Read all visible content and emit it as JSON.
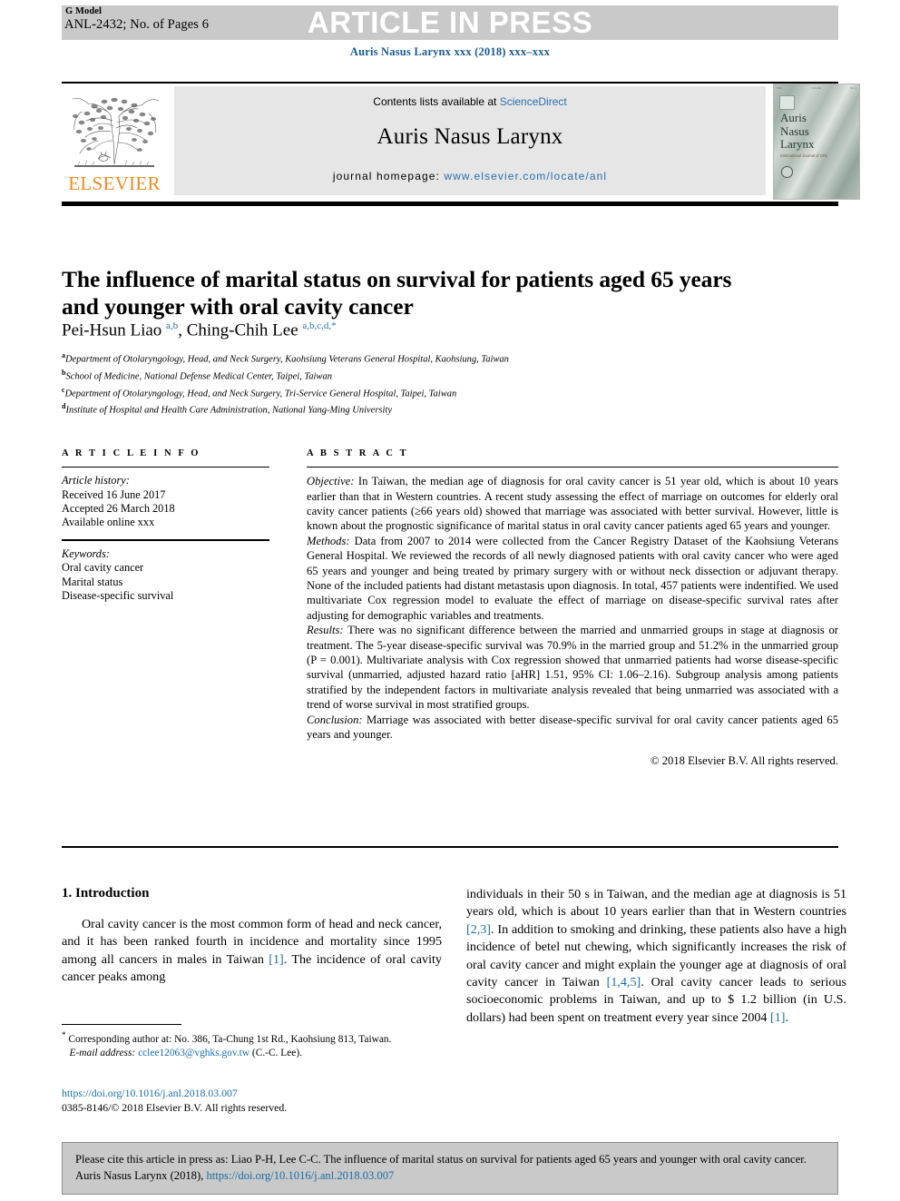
{
  "header": {
    "g_model": "G Model",
    "model_id": "ANL-2432; No. of Pages 6",
    "article_in_press": "ARTICLE IN PRESS",
    "journal_citation": "Auris Nasus Larynx xxx (2018) xxx–xxx"
  },
  "banner": {
    "publisher_word": "ELSEVIER",
    "contents_prefix": "Contents lists available at ",
    "contents_link": "ScienceDirect",
    "journal_title": "Auris Nasus Larynx",
    "homepage_prefix": "journal homepage: ",
    "homepage_url": "www.elsevier.com/locate/anl",
    "cover": {
      "title_line1": "Auris",
      "title_line2": "Nasus",
      "title_line3": "Larynx",
      "subtitle": "International Journal of ORL"
    }
  },
  "article": {
    "title": "The influence of marital status on survival for patients aged 65 years and younger with oral cavity cancer",
    "authors_html": "Pei-Hsun Liao <sup>a,b</sup>, Ching-Chih Lee <sup>a,b,c,d,</sup><sup>*</sup>",
    "affiliations": [
      {
        "marker": "a",
        "text": "Department of Otolaryngology, Head, and Neck Surgery, Kaohsiung Veterans General Hospital, Kaohsiung, Taiwan"
      },
      {
        "marker": "b",
        "text": "School of Medicine, National Defense Medical Center, Taipei, Taiwan"
      },
      {
        "marker": "c",
        "text": "Department of Otolaryngology, Head, and Neck Surgery, Tri-Service General Hospital, Taipei, Taiwan"
      },
      {
        "marker": "d",
        "text": "Institute of Hospital and Health Care Administration, National Yang-Ming University"
      }
    ]
  },
  "article_info": {
    "label": "A R T I C L E   I N F O",
    "history_label": "Article history:",
    "history": [
      "Received 16 June 2017",
      "Accepted 26 March 2018",
      "Available online xxx"
    ],
    "keywords_label": "Keywords:",
    "keywords": [
      "Oral cavity cancer",
      "Marital status",
      "Disease-specific survival"
    ]
  },
  "abstract": {
    "label": "A B S T R A C T",
    "objective_label": "Objective:",
    "objective_text": " In Taiwan, the median age of diagnosis for oral cavity cancer is 51 year old, which is about 10 years earlier than that in Western countries. A recent study assessing the effect of marriage on outcomes for elderly oral cavity cancer patients (≥66 years old) showed that marriage was associated with better survival. However, little is known about the prognostic significance of marital status in oral cavity cancer patients aged 65 years and younger.",
    "methods_label": "Methods:",
    "methods_text": " Data from 2007 to 2014 were collected from the Cancer Registry Dataset of the Kaohsiung Veterans General Hospital. We reviewed the records of all newly diagnosed patients with oral cavity cancer who were aged 65 years and younger and being treated by primary surgery with or without neck dissection or adjuvant therapy. None of the included patients had distant metastasis upon diagnosis. In total, 457 patients were indentified. We used multivariate Cox regression model to evaluate the effect of marriage on disease-specific survival rates after adjusting for demographic variables and treatments.",
    "results_label": "Results:",
    "results_text": " There was no significant difference between the married and unmarried groups in stage at diagnosis or treatment. The 5-year disease-specific survival was 70.9% in the married group and 51.2% in the unmarried group (P = 0.001). Multivariate analysis with Cox regression showed that unmarried patients had worse disease-specific survival (unmarried, adjusted hazard ratio [aHR] 1.51, 95% CI: 1.06–2.16). Subgroup analysis among patients stratified by the independent factors in multivariate analysis revealed that being unmarried was associated with a trend of worse survival in most stratified groups.",
    "conclusion_label": "Conclusion:",
    "conclusion_text": " Marriage was associated with better disease-specific survival for oral cavity cancer patients aged 65 years and younger.",
    "copyright": "© 2018 Elsevier B.V. All rights reserved."
  },
  "introduction": {
    "heading": "1. Introduction",
    "left_para_1": "Oral cavity cancer is the most common form of head and neck cancer, and it has been ranked fourth in incidence and mortality since 1995 among all cancers in males in Taiwan ",
    "left_cite_1": "[1]",
    "left_para_1b": ". The incidence of oral cavity cancer peaks among",
    "right_para_1a": "individuals in their 50 s in Taiwan, and the median age at diagnosis is 51 years old, which is about 10 years earlier than that in Western countries ",
    "right_cite_1": "[2,3]",
    "right_para_1b": ". In addition to smoking and drinking, these patients also have a high incidence of betel nut chewing, which significantly increases the risk of oral cavity cancer and might explain the younger age at diagnosis of oral cavity cancer in Taiwan ",
    "right_cite_2": "[1,4,5]",
    "right_para_1c": ". Oral cavity cancer leads to serious socioeconomic problems in Taiwan, and up to $ 1.2 billion (in U.S. dollars) had been spent on treatment every year since 2004 ",
    "right_cite_3": "[1]",
    "right_para_1d": "."
  },
  "footnotes": {
    "corresponding_marker": "*",
    "corresponding_text": " Corresponding author at: No. 386, Ta-Chung 1st Rd., Kaohsiung 813, Taiwan.",
    "email_label": "E-mail address:",
    "email_address": " cclee12063@vghks.gov.tw",
    "email_suffix": " (C.-C. Lee).",
    "doi_url": "https://doi.org/10.1016/j.anl.2018.03.007",
    "issn_line": "0385-8146/© 2018 Elsevier B.V. All rights reserved."
  },
  "cite_box": {
    "text_before": "Please cite this article in press as: Liao P-H, Lee C-C. The influence of marital status on survival for patients aged 65 years and younger with oral cavity cancer. Auris Nasus Larynx (2018), ",
    "doi": "https://doi.org/10.1016/j.anl.2018.03.007"
  },
  "colors": {
    "link_blue": "#1a6ca8",
    "elsevier_orange": "#f08a1d",
    "band_gray": "#c9c9c9",
    "banner_gray": "#e6e6e6"
  }
}
